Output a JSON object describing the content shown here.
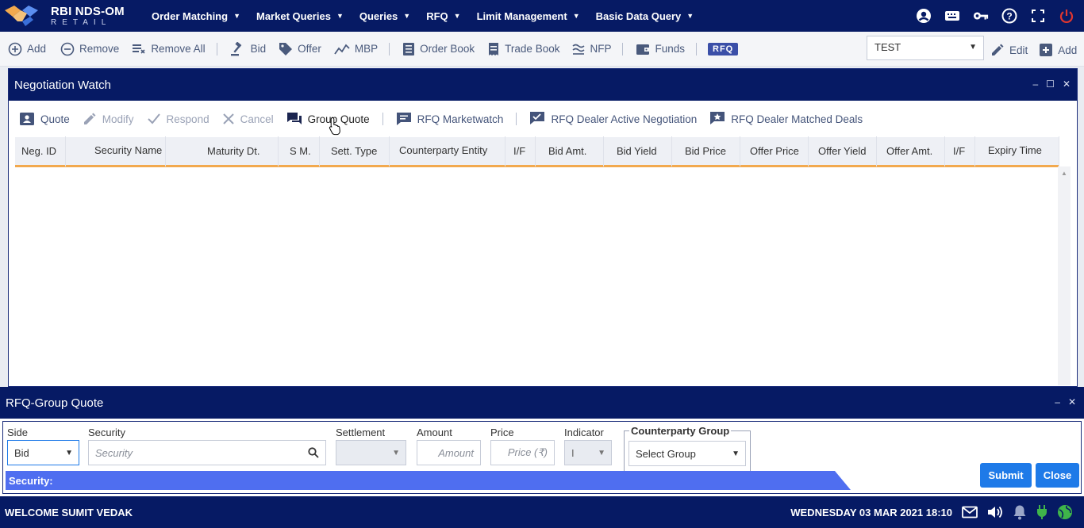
{
  "brand": {
    "title": "RBI NDS-OM",
    "subtitle": "RETAIL"
  },
  "menu": [
    {
      "label": "Order Matching"
    },
    {
      "label": "Market Queries"
    },
    {
      "label": "Queries"
    },
    {
      "label": "RFQ"
    },
    {
      "label": "Limit Management"
    },
    {
      "label": "Basic Data Query"
    }
  ],
  "toolbar": {
    "add": "Add",
    "remove": "Remove",
    "remove_all": "Remove All",
    "bid": "Bid",
    "offer": "Offer",
    "mbp": "MBP",
    "order_book": "Order Book",
    "trade_book": "Trade Book",
    "nfp": "NFP",
    "funds": "Funds",
    "rfq": "RFQ",
    "profile_value": "TEST",
    "edit": "Edit",
    "add_right": "Add"
  },
  "negotiation_watch": {
    "title": "Negotiation Watch",
    "actions": {
      "quote": "Quote",
      "modify": "Modify",
      "respond": "Respond",
      "cancel": "Cancel",
      "group_quote": "Group Quote",
      "rfq_marketwatch": "RFQ Marketwatch",
      "rfq_dealer_active": "RFQ Dealer Active Negotiation",
      "rfq_dealer_matched": "RFQ Dealer Matched Deals"
    },
    "columns": [
      "Neg. ID",
      "Security Name",
      "Maturity Dt.",
      "S M.",
      "Sett. Type",
      "Counterparty Entity",
      "I/F",
      "Bid Amt.",
      "Bid Yield",
      "Bid Price",
      "Offer Price",
      "Offer Yield",
      "Offer Amt.",
      "I/F",
      "Expiry Time"
    ]
  },
  "group_quote": {
    "title": "RFQ-Group Quote",
    "side_label": "Side",
    "side_value": "Bid",
    "security_label": "Security",
    "security_placeholder": "Security",
    "settlement_label": "Settlement",
    "amount_label": "Amount",
    "amount_placeholder": "Amount",
    "price_label": "Price",
    "price_placeholder": "Price (₹)",
    "indicator_label": "Indicator",
    "indicator_value": "I",
    "counterparty_legend": "Counterparty Group",
    "counterparty_value": "Select Group",
    "security_bar": "Security:",
    "submit": "Submit",
    "close": "Close"
  },
  "status": {
    "welcome": "WELCOME SUMIT VEDAK",
    "datetime": "WEDNESDAY 03 MAR 2021 18:10"
  },
  "colors": {
    "nav": "#061a64",
    "accent": "#1e7ae8",
    "underline": "#f2a94e",
    "security_bar": "#4f6ef0"
  }
}
